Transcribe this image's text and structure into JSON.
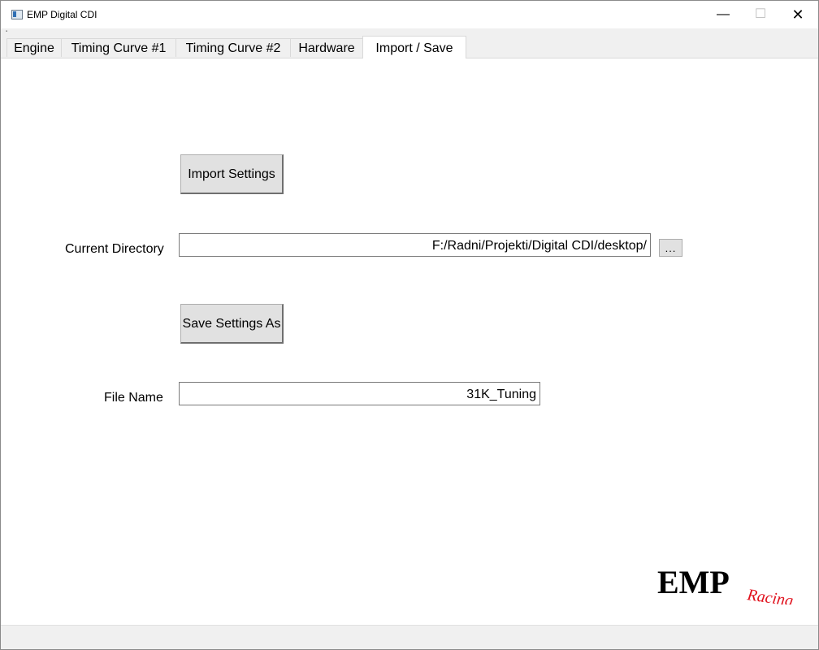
{
  "window": {
    "title": "EMP Digital CDI",
    "controls": {
      "minimize": "—",
      "maximize": "☐",
      "close": "✕"
    }
  },
  "tabs": [
    {
      "label": "Engine",
      "active": false
    },
    {
      "label": "Timing Curve #1",
      "active": false
    },
    {
      "label": "Timing Curve #2",
      "active": false
    },
    {
      "label": "Hardware",
      "active": false
    },
    {
      "label": "Import / Save",
      "active": true
    }
  ],
  "import_save": {
    "import_button": "Import Settings",
    "current_directory_label": "Current Directory",
    "current_directory_value": "F:/Radni/Projekti/Digital CDI/desktop/",
    "browse_button": "...",
    "save_button": "Save Settings As",
    "file_name_label": "File Name",
    "file_name_value": "31K_Tuning"
  },
  "logo": {
    "main": "EMP",
    "sub": "Racing",
    "main_color": "#000000",
    "sub_color": "#e0101c"
  }
}
